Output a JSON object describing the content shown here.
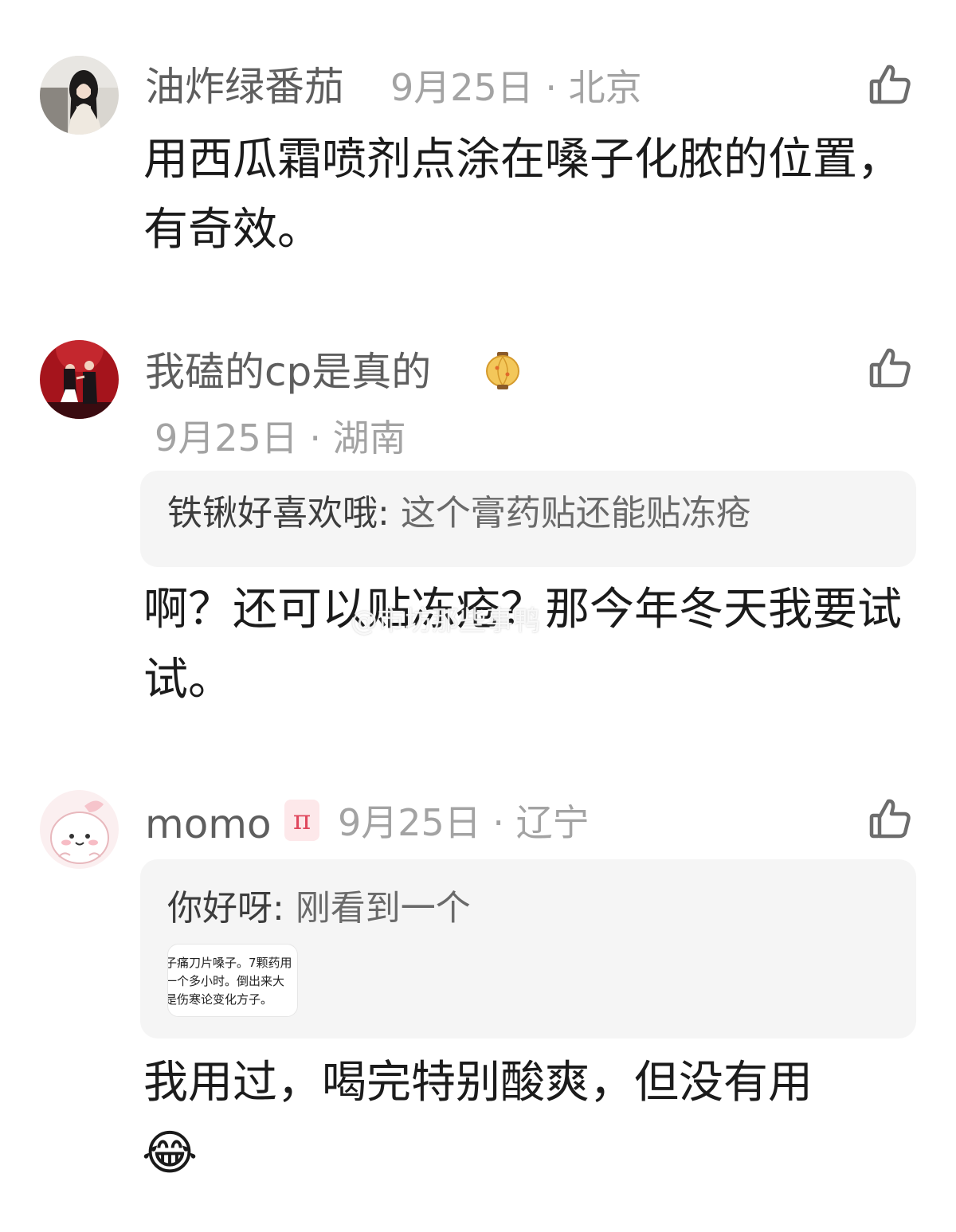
{
  "comments": [
    {
      "username": "油炸绿番茄",
      "meta": "9月25日 · 北京",
      "body": "用西瓜霜喷剂点涂在嗓子化脓的位置，有奇效。"
    },
    {
      "username": "我磕的cp是真的",
      "badge": "lantern-icon",
      "meta": "9月25日 · 湖南",
      "quote": {
        "name": "铁锹好喜欢哦: ",
        "text": "这个膏药贴还能贴冻疮"
      },
      "body": "啊？还可以贴冻疮？那今年冬天我要试试。"
    },
    {
      "username": "momo",
      "badge": "π",
      "meta": "9月25日 · 辽宁",
      "quote": {
        "name": "你好呀: ",
        "text": "刚看到一个",
        "thumbnail_lines": [
          "子痛刀片嗓子。7颗药用",
          "一个多小时。倒出来大",
          "是伤寒论变化方子。"
        ]
      },
      "body": "我用过，喝完特别酸爽，但没有用",
      "emoji": "😂"
    }
  ],
  "watermark": "@市坊那些事鸭",
  "colors": {
    "username": "#5e5e5e",
    "meta": "#a3a3a3",
    "quote_bg": "#f5f5f5",
    "badge": "#e0475d"
  }
}
